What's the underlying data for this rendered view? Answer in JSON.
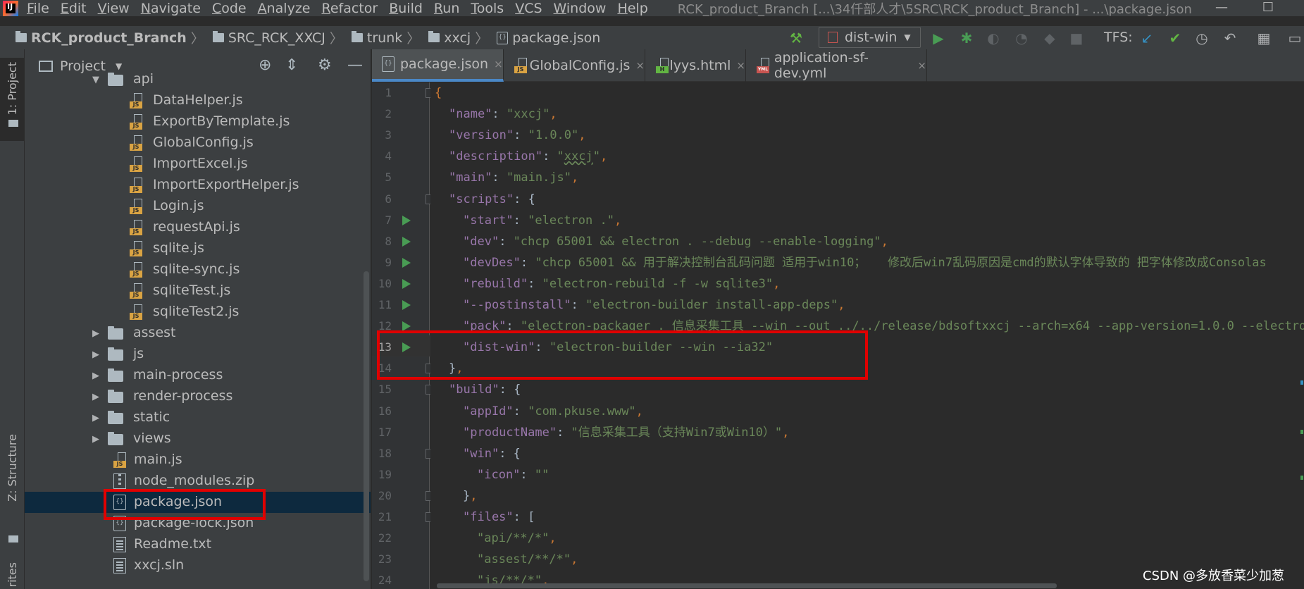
{
  "menubar": {
    "logo_text": "IJ",
    "items": [
      "File",
      "Edit",
      "View",
      "Navigate",
      "Code",
      "Analyze",
      "Refactor",
      "Build",
      "Run",
      "Tools",
      "VCS",
      "Window",
      "Help"
    ],
    "window_title": "RCK_product_Branch [...\\34仟部人才\\5SRC\\RCK_product_Branch] - ...\\package.json",
    "minimize": "—",
    "maximize": "☐"
  },
  "breadcrumb": {
    "items": [
      "RCK_product_Branch",
      "SRC_RCK_XXCJ",
      "trunk",
      "xxcj",
      "package.json"
    ]
  },
  "toolbar": {
    "run_config": "dist-win",
    "tfs_label": "TFS:"
  },
  "left_stripe": {
    "project_tab": "1: Project",
    "structure_tab": "Z: Structure",
    "favorites_tab": "rites"
  },
  "project_panel": {
    "title": "Project",
    "tree": [
      {
        "label": "api",
        "type": "folder",
        "expanded": true
      },
      {
        "label": "DataHelper.js",
        "type": "js"
      },
      {
        "label": "ExportByTemplate.js",
        "type": "js"
      },
      {
        "label": "GlobalConfig.js",
        "type": "js"
      },
      {
        "label": "ImportExcel.js",
        "type": "js"
      },
      {
        "label": "ImportExportHelper.js",
        "type": "js"
      },
      {
        "label": "Login.js",
        "type": "js"
      },
      {
        "label": "requestApi.js",
        "type": "js"
      },
      {
        "label": "sqlite.js",
        "type": "js"
      },
      {
        "label": "sqlite-sync.js",
        "type": "js"
      },
      {
        "label": "sqliteTest.js",
        "type": "js"
      },
      {
        "label": "sqliteTest2.js",
        "type": "js"
      },
      {
        "label": "assest",
        "type": "folder"
      },
      {
        "label": "js",
        "type": "folder"
      },
      {
        "label": "main-process",
        "type": "folder"
      },
      {
        "label": "render-process",
        "type": "folder"
      },
      {
        "label": "static",
        "type": "folder"
      },
      {
        "label": "views",
        "type": "folder"
      },
      {
        "label": "main.js",
        "type": "js"
      },
      {
        "label": "node_modules.zip",
        "type": "zip"
      },
      {
        "label": "package.json",
        "type": "json",
        "selected": true
      },
      {
        "label": "package-lock.json",
        "type": "json"
      },
      {
        "label": "Readme.txt",
        "type": "txt"
      },
      {
        "label": "xxcj.sln",
        "type": "txt"
      }
    ]
  },
  "editor": {
    "tabs": [
      {
        "label": "package.json",
        "icon": "json",
        "active": true
      },
      {
        "label": "GlobalConfig.js",
        "icon": "js"
      },
      {
        "label": "lyys.html",
        "icon": "html"
      },
      {
        "label": "application-sf-dev.yml",
        "icon": "yml"
      }
    ],
    "close_glyph": "×",
    "lines": [
      {
        "n": "1",
        "indent": 0,
        "parts": [
          [
            "p",
            "{"
          ]
        ]
      },
      {
        "n": "2",
        "indent": 1,
        "parts": [
          [
            "k",
            "\"name\""
          ],
          [
            "n",
            ": "
          ],
          [
            "s",
            "\"xxcj\""
          ],
          [
            "p",
            ","
          ]
        ]
      },
      {
        "n": "3",
        "indent": 1,
        "parts": [
          [
            "k",
            "\"version\""
          ],
          [
            "n",
            ": "
          ],
          [
            "s",
            "\"1.0.0\""
          ],
          [
            "p",
            ","
          ]
        ]
      },
      {
        "n": "4",
        "indent": 1,
        "parts": [
          [
            "k",
            "\"description\""
          ],
          [
            "n",
            ": "
          ],
          [
            "s",
            "\""
          ],
          [
            "su",
            "xxcj"
          ],
          [
            "s",
            "\""
          ],
          [
            "p",
            ","
          ]
        ]
      },
      {
        "n": "5",
        "indent": 1,
        "parts": [
          [
            "k",
            "\"main\""
          ],
          [
            "n",
            ": "
          ],
          [
            "s",
            "\"main.js\""
          ],
          [
            "p",
            ","
          ]
        ]
      },
      {
        "n": "6",
        "indent": 1,
        "parts": [
          [
            "k",
            "\"scripts\""
          ],
          [
            "n",
            ": {"
          ]
        ]
      },
      {
        "n": "7",
        "indent": 2,
        "parts": [
          [
            "k",
            "\"start\""
          ],
          [
            "n",
            ": "
          ],
          [
            "s",
            "\"electron .\""
          ],
          [
            "p",
            ","
          ]
        ]
      },
      {
        "n": "8",
        "indent": 2,
        "parts": [
          [
            "k",
            "\"dev\""
          ],
          [
            "n",
            ": "
          ],
          [
            "s",
            "\"chcp 65001 && electron . --debug --enable-logging\""
          ],
          [
            "p",
            ","
          ]
        ]
      },
      {
        "n": "9",
        "indent": 2,
        "parts": [
          [
            "k",
            "\"devDes\""
          ],
          [
            "n",
            ": "
          ],
          [
            "s",
            "\"chcp 65001 && 用于解决控制台乱码问题 适用于win10；   修改后win7乱码原因是cmd的默认字体导致的 把字体修改成Consolas"
          ]
        ]
      },
      {
        "n": "10",
        "indent": 2,
        "parts": [
          [
            "k",
            "\"rebuild\""
          ],
          [
            "n",
            ": "
          ],
          [
            "s",
            "\"electron-rebuild -f -w sqlite3\""
          ],
          [
            "p",
            ","
          ]
        ]
      },
      {
        "n": "11",
        "indent": 2,
        "parts": [
          [
            "k",
            "\"--postinstall\""
          ],
          [
            "n",
            ": "
          ],
          [
            "s",
            "\"electron-builder install-app-deps\""
          ],
          [
            "p",
            ","
          ]
        ]
      },
      {
        "n": "12",
        "indent": 2,
        "parts": [
          [
            "k",
            "\"pack\""
          ],
          [
            "n",
            ": "
          ],
          [
            "s",
            "\"electron-packager . 信息采集工具 --win --out ../../release/bdsoftxxcj --arch=x64 --app-version=1.0.0 --electron"
          ]
        ]
      },
      {
        "n": "13",
        "indent": 2,
        "parts": [
          [
            "k",
            "\"dist-win\""
          ],
          [
            "n",
            ": "
          ],
          [
            "s",
            "\"electron-builder --win --ia32\""
          ]
        ]
      },
      {
        "n": "14",
        "indent": 1,
        "parts": [
          [
            "n",
            "}"
          ],
          [
            "p",
            ","
          ]
        ]
      },
      {
        "n": "15",
        "indent": 1,
        "parts": [
          [
            "k",
            "\"build\""
          ],
          [
            "n",
            ": {"
          ]
        ]
      },
      {
        "n": "16",
        "indent": 2,
        "parts": [
          [
            "k",
            "\"appId\""
          ],
          [
            "n",
            ": "
          ],
          [
            "s",
            "\"com.pkuse.www\""
          ],
          [
            "p",
            ","
          ]
        ]
      },
      {
        "n": "17",
        "indent": 2,
        "parts": [
          [
            "k",
            "\"productName\""
          ],
          [
            "n",
            ": "
          ],
          [
            "s",
            "\"信息采集工具（支持Win7或Win10）\""
          ],
          [
            "p",
            ","
          ]
        ]
      },
      {
        "n": "18",
        "indent": 2,
        "parts": [
          [
            "k",
            "\"win\""
          ],
          [
            "n",
            ": {"
          ]
        ]
      },
      {
        "n": "19",
        "indent": 3,
        "parts": [
          [
            "k",
            "\"icon\""
          ],
          [
            "n",
            ": "
          ],
          [
            "s",
            "\"\""
          ]
        ]
      },
      {
        "n": "20",
        "indent": 2,
        "parts": [
          [
            "n",
            "}"
          ],
          [
            "p",
            ","
          ]
        ]
      },
      {
        "n": "21",
        "indent": 2,
        "parts": [
          [
            "k",
            "\"files\""
          ],
          [
            "n",
            ": ["
          ]
        ]
      },
      {
        "n": "22",
        "indent": 3,
        "parts": [
          [
            "s",
            "\"api/**/*\""
          ],
          [
            "p",
            ","
          ]
        ]
      },
      {
        "n": "23",
        "indent": 3,
        "parts": [
          [
            "s",
            "\"assest/**/*\""
          ],
          [
            "p",
            ","
          ]
        ]
      },
      {
        "n": "24",
        "indent": 3,
        "parts": [
          [
            "s",
            "\"js/**/*\""
          ],
          [
            "p",
            ","
          ]
        ]
      }
    ],
    "run_lines": [
      "7",
      "8",
      "9",
      "10",
      "11",
      "12",
      "13"
    ],
    "fold_lines": [
      "1",
      "6",
      "14",
      "15",
      "18",
      "20",
      "21"
    ],
    "current_line": "13"
  },
  "watermark": "CSDN @多放香菜少加葱",
  "colors": {
    "accent": "#4a88c7",
    "highlight_box": "#e00000",
    "run_marker": "#499c54",
    "key": "#9876aa",
    "string": "#6a8759",
    "punct": "#cc7832"
  }
}
